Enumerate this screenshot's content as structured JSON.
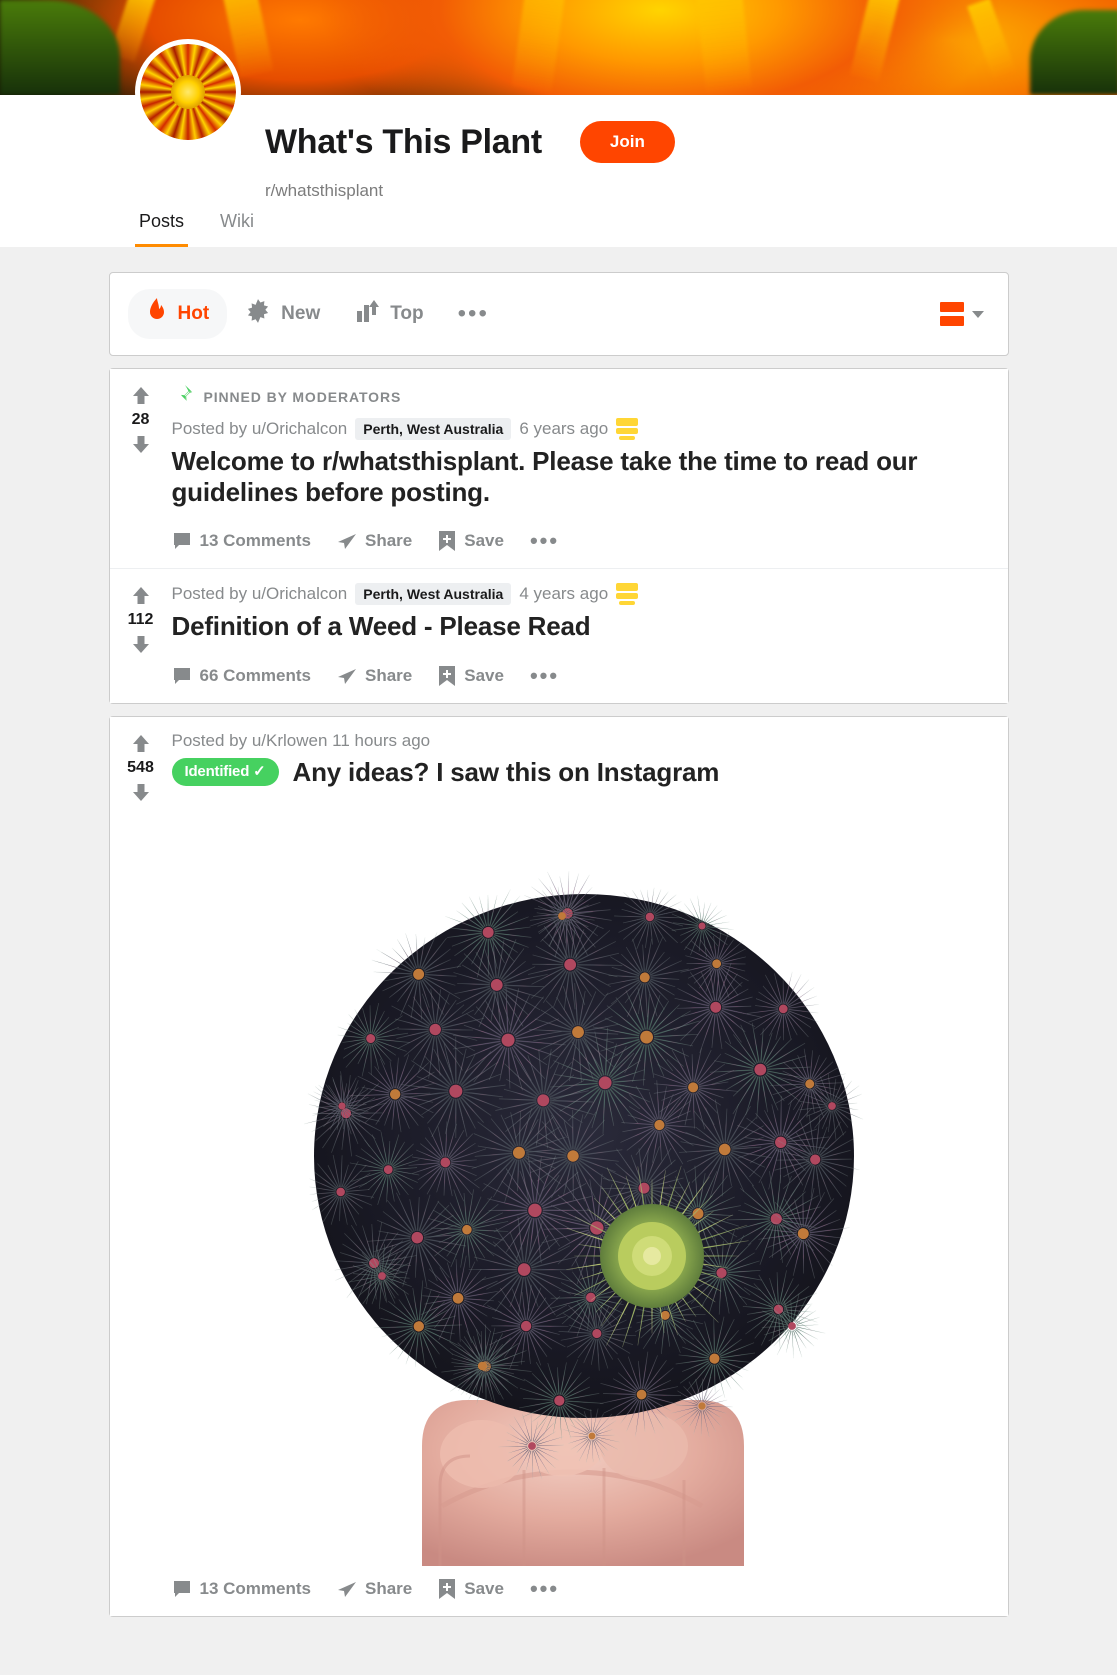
{
  "banner": {
    "alt": "orange-flower-banner"
  },
  "community": {
    "avatar_icon": "marigold-flower-avatar",
    "title": "What's This Plant",
    "subreddit": "r/whatsthisplant",
    "join_label": "Join",
    "tabs": [
      {
        "label": "Posts",
        "active": true
      },
      {
        "label": "Wiki",
        "active": false
      }
    ]
  },
  "sortbar": {
    "options": [
      {
        "label": "Hot",
        "icon": "flame-icon",
        "active": true
      },
      {
        "label": "New",
        "icon": "sparkle-icon",
        "active": false
      },
      {
        "label": "Top",
        "icon": "bar-chart-icon",
        "active": false
      }
    ],
    "more_label": "•••",
    "view_mode_icon": "card-view-icon",
    "view_mode_color": "#ff4500"
  },
  "posts": [
    {
      "pinned": true,
      "pinned_label": "PINNED BY MODERATORS",
      "pin_icon": "pin-icon",
      "score": "28",
      "posted_by": "Posted by u/Orichalcon",
      "flair": "Perth, West Australia",
      "time": "6 years ago",
      "award_icon": "gold-award-icon",
      "title": "Welcome to r/whatsthisplant. Please take the time to read our guidelines before posting.",
      "comments": "13 Comments",
      "share": "Share",
      "save": "Save",
      "more": "•••"
    },
    {
      "pinned": false,
      "score": "112",
      "posted_by": "Posted by u/Orichalcon",
      "flair": "Perth, West Australia",
      "time": "4 years ago",
      "award_icon": "gold-award-icon",
      "title": "Definition of a Weed - Please Read",
      "comments": "66 Comments",
      "share": "Share",
      "save": "Save",
      "more": "•••"
    },
    {
      "pinned": false,
      "score": "548",
      "posted_by": "Posted by u/Krlowen 11 hours ago",
      "post_flair": "Identified ✓",
      "post_flair_color": "#46d160",
      "title": "Any ideas? I saw this on Instagram",
      "image_alt": "succulent-rosette-photo",
      "comments": "13 Comments",
      "share": "Share",
      "save": "Save",
      "more": "•••"
    }
  ]
}
